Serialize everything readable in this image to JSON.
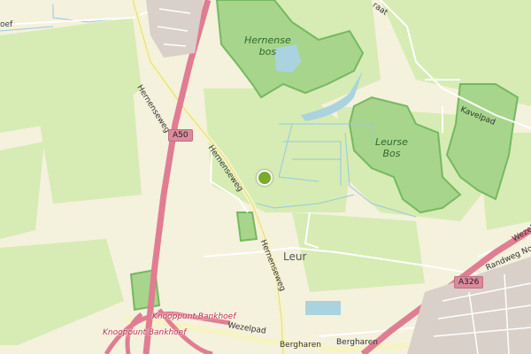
{
  "map": {
    "woods": [
      {
        "line1": "Hernense",
        "line2": "bos"
      },
      {
        "line1": "Leurse",
        "line2": "Bos"
      }
    ],
    "places": {
      "leur": "Leur"
    },
    "streets": {
      "hernenseweg_1": "Hernenseweg",
      "hernenseweg_2": "Hernenseweg",
      "hernenseweg_3": "Hernenseweg",
      "kavelpad": "Kavelpad",
      "wezelpad": "Wezelpad",
      "bergharen_1": "Bergharen",
      "bergharen_2": "Bergharen",
      "randweg": "Randweg Noo",
      "wezel_edge": "Wezel",
      "hoef_edge": "oef",
      "raat_edge": "raat"
    },
    "junctions": [
      "Knooppunt Bankhoef",
      "Knooppunt Bankhoef"
    ],
    "shields": {
      "a50": "A50",
      "a326": "A326"
    },
    "colors": {
      "background": "#f4f1dc",
      "meadow": "#d6ecb4",
      "forest": "#a7d58c",
      "forest_border": "#76b861",
      "motorway": "#e07d92",
      "water": "#aad3df",
      "marker": "#7aab2a"
    }
  }
}
